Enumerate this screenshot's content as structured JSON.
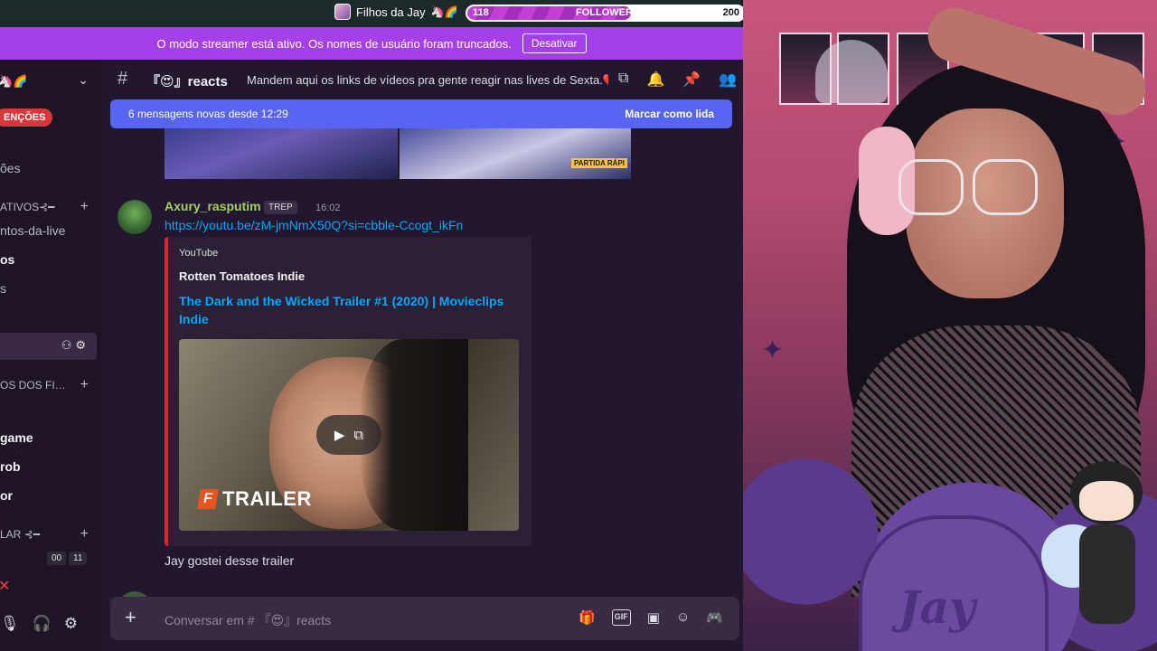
{
  "stream_overlay": {
    "channel_name": "Filhos da Jay",
    "channel_emojis": "🦄🌈",
    "followers_current": "118",
    "followers_label": "FOLLOWERS",
    "followers_goal": "200",
    "followers_progress": 0.59
  },
  "streamer_banner": {
    "message": "O modo streamer está ativo. Os nomes de usuário foram truncados.",
    "button": "Desativar"
  },
  "sidebar": {
    "server_name": "🦄🌈",
    "mentions_badge": "ENÇÕES",
    "items": [
      {
        "label": "ões"
      },
      {
        "label": "ATIVOS⊰━"
      },
      {
        "label": "ntos-da-live"
      },
      {
        "label": "os"
      },
      {
        "label": "s"
      },
      {
        "label": "OS DOS FI…"
      },
      {
        "label": "game"
      },
      {
        "label": "rob"
      },
      {
        "label": "or"
      },
      {
        "label": "LAR ⊰━"
      }
    ],
    "voice_counts": [
      "00",
      "11"
    ]
  },
  "channel": {
    "name": "『😍』reacts",
    "topic": "Mandem aqui os links de vídeos pra gente reagir nas lives de Sexta.❤️...",
    "new_messages": "6 mensagens novas desde 12:29",
    "mark_read": "Marcar como lida",
    "preview_tag": "PARTIDA RÁPI"
  },
  "messages": [
    {
      "author": "Axury_rasputim",
      "badge": "TREP",
      "time": "16:02",
      "link": "https://youtu.be/zM-jmNmX50Q?si=cbble-Ccogt_ikFn",
      "embed": {
        "provider": "YouTube",
        "author": "Rotten Tomatoes Indie",
        "title": "The Dark and the Wicked Trailer #1 (2020) | Movieclips Indie",
        "thumbnail_text": "TRAILER",
        "thumbnail_logo": "F"
      }
    },
    {
      "text": "Jay gostei desse trailer"
    }
  ],
  "composer": {
    "placeholder": "Conversar em # 『😍』reacts",
    "gif_label": "GIF"
  },
  "webcam": {
    "tombstone_text": "Jay"
  },
  "colors": {
    "accent": "#5865f2",
    "streamer_banner": "#a53fe8",
    "mention": "#da373c",
    "username": "#a4d15f",
    "link": "#00a8fc"
  }
}
